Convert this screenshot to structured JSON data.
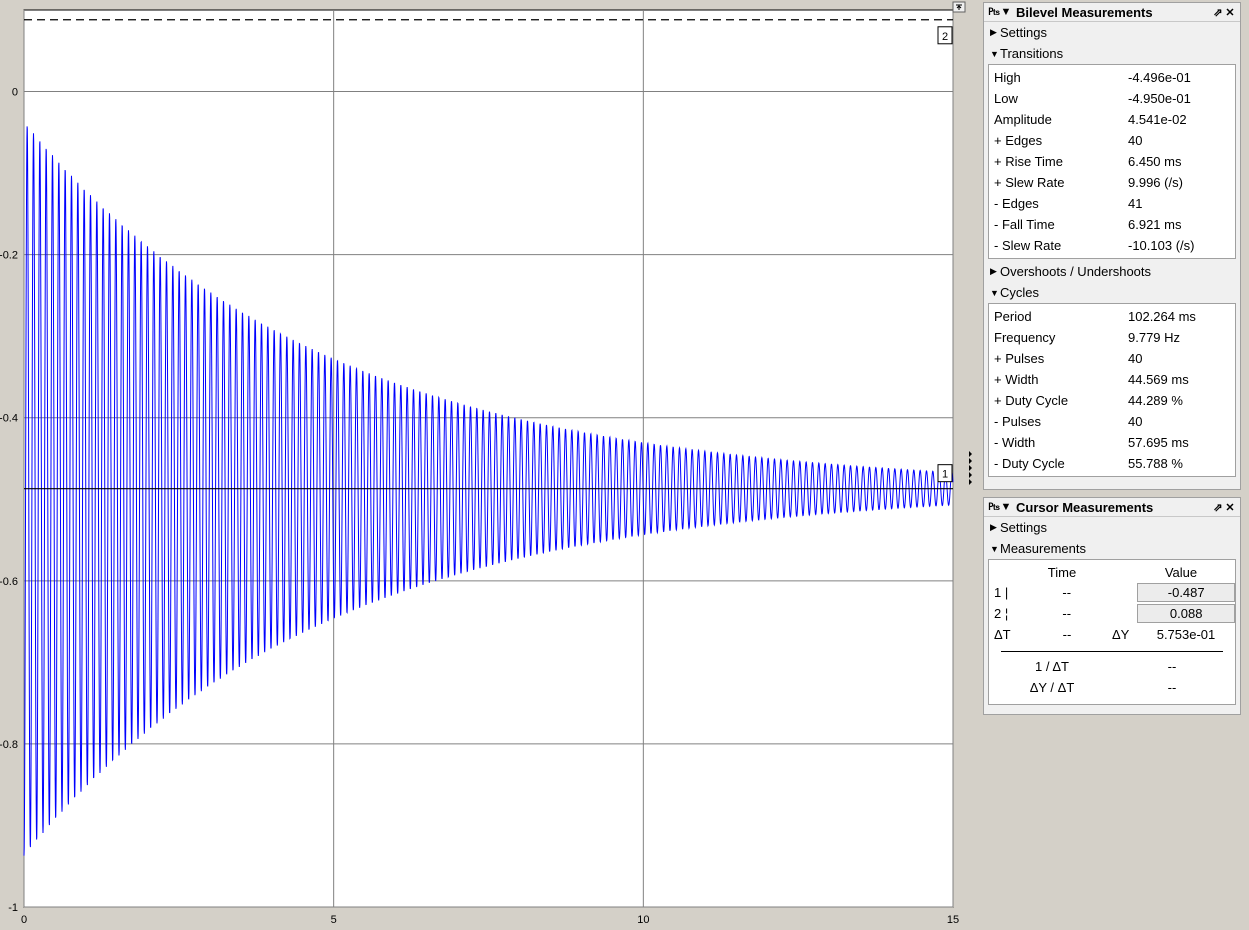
{
  "chart_data": {
    "type": "line",
    "xlim": [
      0,
      15
    ],
    "ylim": [
      -1.0,
      0.1
    ],
    "x_ticks": [
      "0",
      "5",
      "10",
      "15"
    ],
    "y_ticks": [
      "0",
      "-0.2",
      "-0.4",
      "-0.6",
      "-0.8",
      "-1"
    ],
    "grid": true,
    "series": [
      {
        "color": "#0000ff",
        "kind": "damped-oscillation",
        "center": -0.487,
        "frequency_hz": 9.779,
        "initial_amplitude": 0.45,
        "initial_peak": -0.03,
        "initial_trough": -0.91,
        "final_amplitude": 0.02,
        "x_end": 15
      }
    ],
    "cursors": [
      {
        "label": "1",
        "y": -0.487,
        "style": "solid"
      },
      {
        "label": "2",
        "y": 0.088,
        "style": "dashed"
      }
    ]
  },
  "bilevel": {
    "title": "Bilevel Measurements",
    "settings_label": "Settings",
    "transitions_label": "Transitions",
    "transitions": [
      {
        "label": "High",
        "value": "-4.496e-01"
      },
      {
        "label": "Low",
        "value": "-4.950e-01"
      },
      {
        "label": "Amplitude",
        "value": " 4.541e-02"
      },
      {
        "label": "+ Edges",
        "value": "40"
      },
      {
        "label": "+ Rise Time",
        "value": " 6.450 ms"
      },
      {
        "label": "+ Slew Rate",
        "value": " 9.996 (/s)"
      },
      {
        "label": "- Edges",
        "value": "41"
      },
      {
        "label": "- Fall Time",
        "value": " 6.921 ms"
      },
      {
        "label": "- Slew Rate",
        "value": "-10.103 (/s)"
      }
    ],
    "overshoots_label": "Overshoots / Undershoots",
    "cycles_label": "Cycles",
    "cycles": [
      {
        "label": "Period",
        "value": " 102.264 ms"
      },
      {
        "label": "Frequency",
        "value": " 9.779 Hz"
      },
      {
        "label": "+ Pulses",
        "value": "40"
      },
      {
        "label": "+ Width",
        "value": " 44.569 ms"
      },
      {
        "label": "+ Duty Cycle",
        "value": " 44.289 %"
      },
      {
        "label": "- Pulses",
        "value": "40"
      },
      {
        "label": "- Width",
        "value": " 57.695 ms"
      },
      {
        "label": "- Duty Cycle",
        "value": " 55.788 %"
      }
    ]
  },
  "cursor": {
    "title": "Cursor Measurements",
    "settings_label": "Settings",
    "measurements_label": "Measurements",
    "time_header": "Time",
    "value_header": "Value",
    "row1_label": "1 |",
    "row1_time": "--",
    "row1_value": "-0.487",
    "row2_label": "2 ¦",
    "row2_time": "--",
    "row2_value": "0.088",
    "dt_label": "ΔT",
    "dt_value": "--",
    "dy_label": "ΔY",
    "dy_value": "5.753e-01",
    "inv_dt_label": "1 / ΔT",
    "inv_dt_value": "--",
    "dydt_label": "ΔY / ΔT",
    "dydt_value": "--"
  },
  "icons": {
    "dock": "pin-icon",
    "collapse": "triangle-down-icon",
    "undock": "undock-icon",
    "close": "close-icon"
  }
}
